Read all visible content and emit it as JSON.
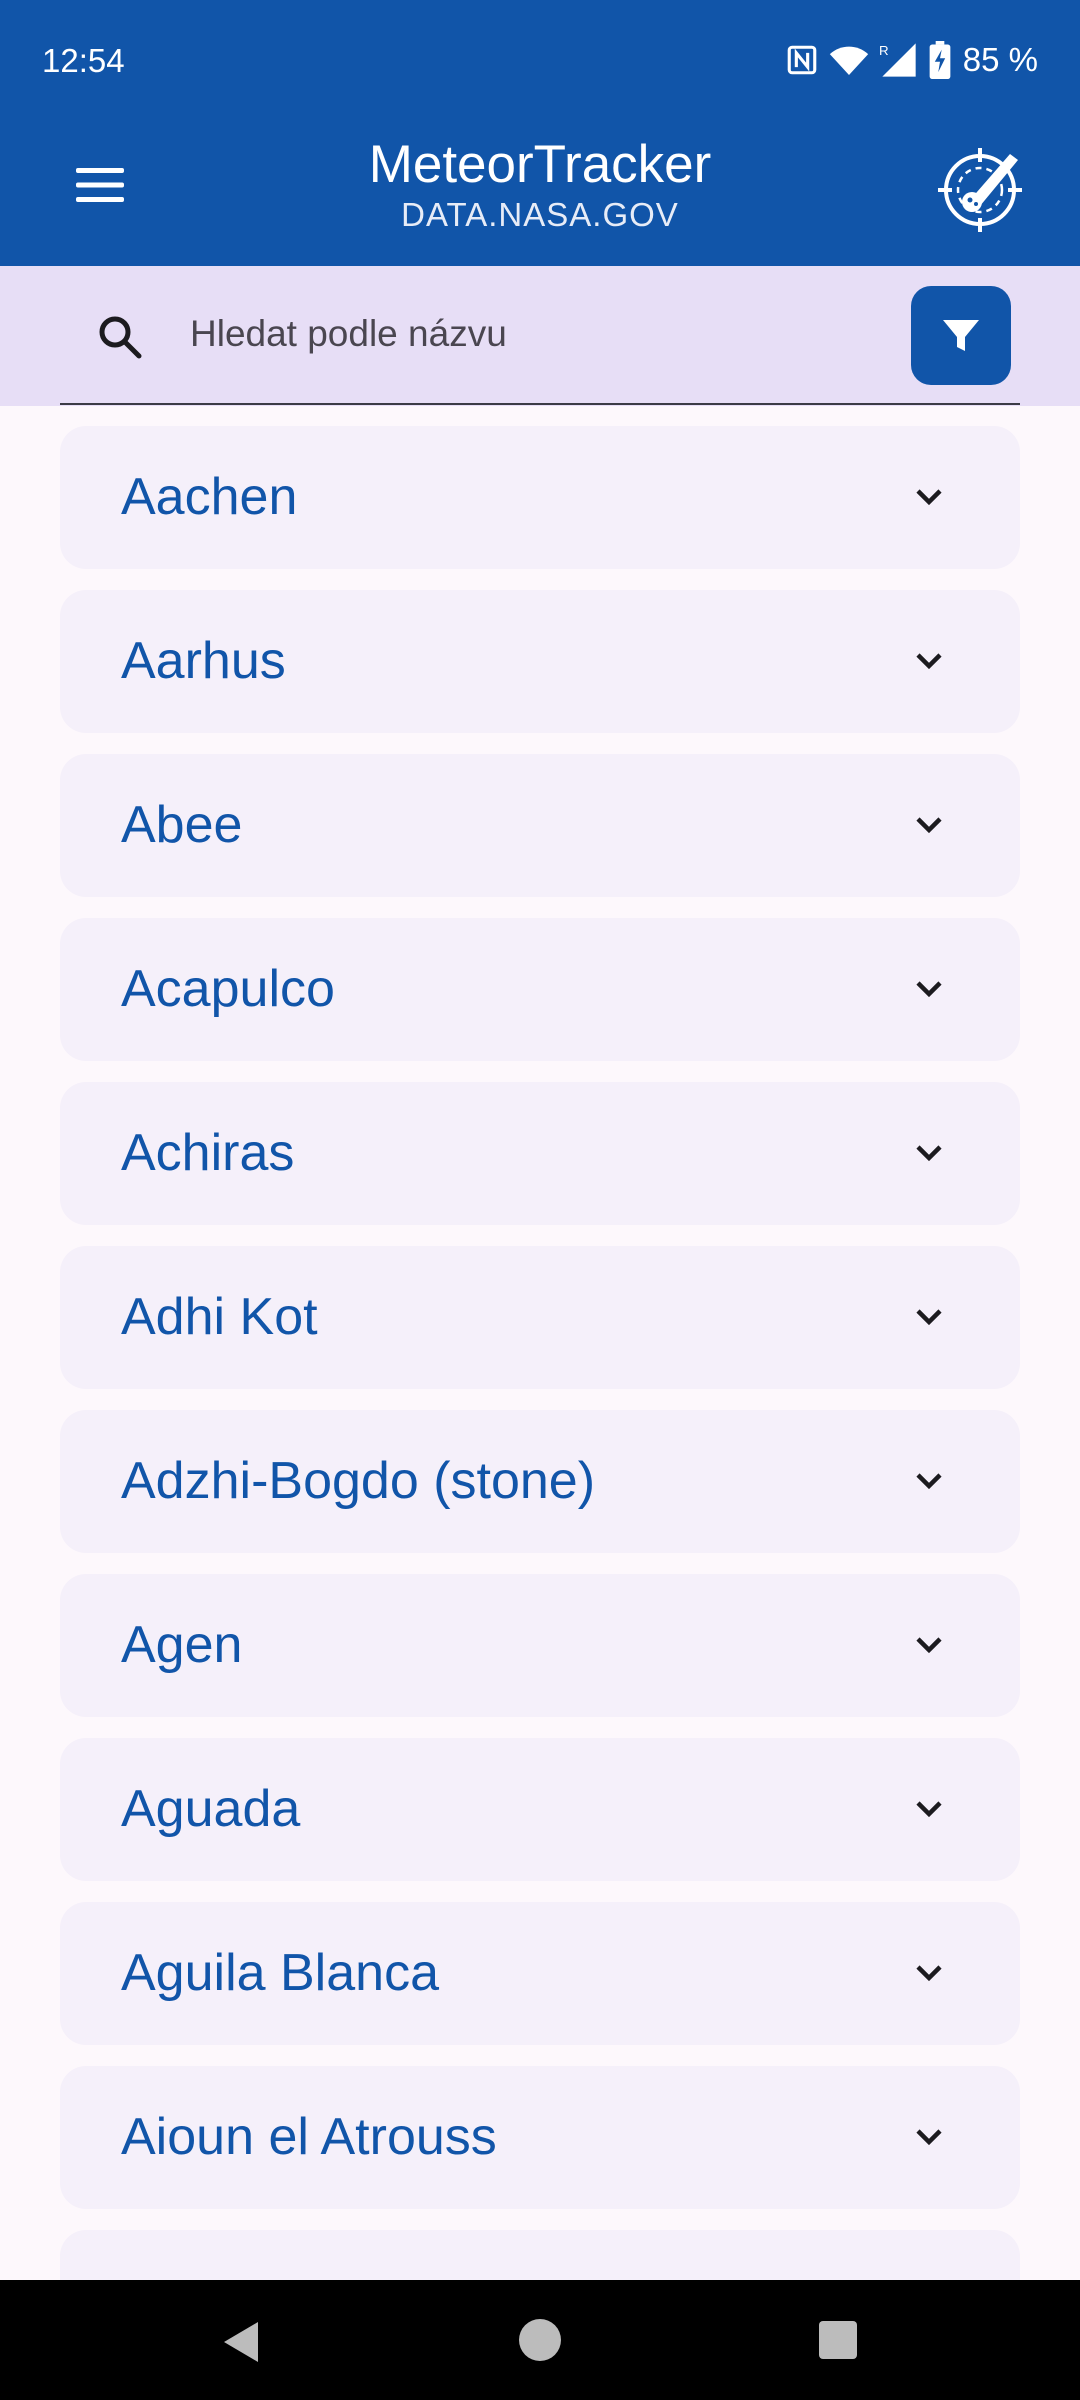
{
  "status_bar": {
    "time": "12:54",
    "battery": "85 %",
    "icons": [
      "nfc-icon",
      "wifi-icon",
      "signal-icon",
      "battery-charging-icon"
    ]
  },
  "app_bar": {
    "title": "MeteorTracker",
    "subtitle": "DATA.NASA.GOV",
    "menu_icon": "hamburger-menu-icon",
    "logo_icon": "meteor-logo-icon"
  },
  "search": {
    "placeholder": "Hledat podle názvu",
    "value": "",
    "filter_icon": "filter-icon"
  },
  "meteorites": [
    {
      "name": "Aachen"
    },
    {
      "name": "Aarhus"
    },
    {
      "name": "Abee"
    },
    {
      "name": "Acapulco"
    },
    {
      "name": "Achiras"
    },
    {
      "name": "Adhi Kot"
    },
    {
      "name": "Adzhi-Bogdo (stone)"
    },
    {
      "name": "Agen"
    },
    {
      "name": "Aguada"
    },
    {
      "name": "Aguila Blanca"
    },
    {
      "name": "Aioun el Atrouss"
    },
    {
      "name": ""
    }
  ],
  "colors": {
    "primary": "#1155a9",
    "search_bg": "#e7def6",
    "card_bg": "#f5f0fa",
    "page_bg": "#fdf8fc"
  }
}
